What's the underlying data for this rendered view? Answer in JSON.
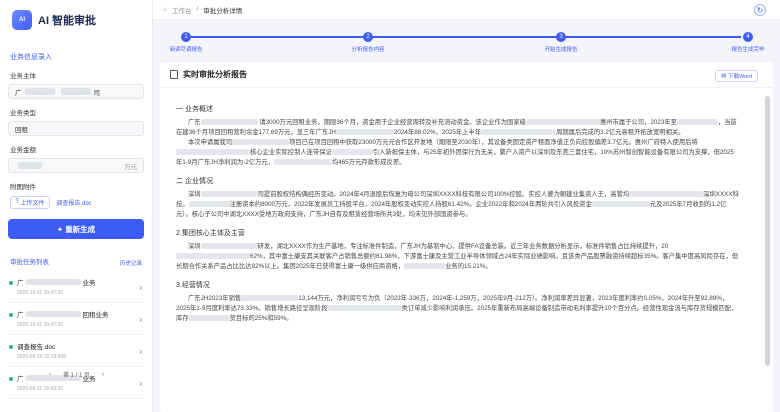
{
  "app": {
    "logo_mark": "AI",
    "title": "AI 智能审批"
  },
  "sidebar": {
    "section_title": "业务信息录入",
    "fields": [
      {
        "label": "业务主体",
        "value_prefix": "广",
        "value_suffix": "司"
      },
      {
        "label": "业务类型",
        "value": "回租"
      },
      {
        "label": "业务金额",
        "value": "",
        "suffix": "万元"
      }
    ],
    "attachments_label": "附图附件",
    "upload_label": "上传文件",
    "file_name": "调查报告.doc",
    "regen_label": "重新生成",
    "tasks_title": "审批任务列表",
    "history_label": "历史记录",
    "tasks": [
      {
        "name_prefix": "广",
        "name_suffix": "业务",
        "time": "2025-10-11 10:47:20"
      },
      {
        "name_prefix": "广",
        "name_suffix": "回租业务",
        "time": "2025-10-11 10:47:20"
      },
      {
        "name": "调查报告.doc",
        "time": "2025-09-10 22:29 836"
      },
      {
        "name_prefix": "广",
        "name_suffix": "业务",
        "time": "2025-09-11 15:43:30"
      },
      {
        "name_prefix": "广",
        "name_suffix": "",
        "time": ""
      }
    ],
    "pager": {
      "prev": "‹",
      "text": "第 1 / 1 页",
      "next": "›"
    }
  },
  "topbar": {
    "home": "工作台",
    "sep": "/",
    "current": "审批分析详情"
  },
  "steps": [
    {
      "num": "1",
      "label": "阅读尽调报告"
    },
    {
      "num": "2",
      "label": "分析报告内容"
    },
    {
      "num": "3",
      "label": "开始生成报告"
    },
    {
      "num": "4",
      "label": "报告生成完毕"
    }
  ],
  "report": {
    "title": "实时审批分析报告",
    "download_label": "下载Word",
    "sections": [
      {
        "heading": "一 业务概述",
        "paras": [
          "广东[BLUR]  请3000万元回租业务，期限36个月，资金用于企业经营周转及补充流动资金。该企业作为国家级[BLUR]惠州市属子公司，2023年至[BLUR]，当前在建36个月项目回租营利余金177.69万元，显三年广东JH[BLUR]2024年88.02%，2025年上半年[BLUR]周期属后完成的3.2亿元高租开拓放宽明相关。",
          "本次申请属我司[BLUR]项目已在项目回租中获取23000万元元合作区开发地（期限至2030年），其设备类固定资产租面净值正负向控股偏差3.7亿元。惠州广府特入使用后将[BLUR]核心企业实际控制人连带保证[BLUR]引入新担保主体，与25年初外团保行为无关，繁户入资产以深圳及东莞三套住宅，10%苏州智创智能设备有限公司为支撑，但2025年1-9月广东JH净利润为-2亿万元，[BLUR]均465万元存款形成反差。"
        ]
      },
      {
        "heading": "二 企业情况",
        "paras": [
          "深圳[BLUR]司提前股权结构偶经历变动。2024年4月退股后恢复为母公司深圳XXXX科技有限公司100%控股。实控人婆为朝建业集资人王，高管均[BLUR]深圳XXXX科技。[BLUR]注册资本约8000万元，2022年发展员工持股平台，2024年股权变动实控人持股61.42%。企业2022年和2024年两轮共引入风投资金[BLUR]元及2025年7月收到的1.2亿元）。核心子公司中湖北XXXX受地方政府支持，广东JH自有及租赁经营场所共3处，均未见外部国资参与。"
        ]
      },
      {
        "heading": "2.集团核心主体及主营",
        "paras": [
          "深圳[BLUR]研发，湖北XXXX作为生产基地，专注标准件制造，广东JH为基制中心，提供FA设备总装。近三年业务数据分析显示，标准件销售占比持续提升，20[BLUR]62%，其中富士康支其关联客户占销售总额约61.98%，下游富士康及主营工业半导体领域占24年实际业绩影响。且该类产品股票融资持续超标35%。客户集中度高风险存在，但长期合作关系产品占比比达82%以上。集团2025年已获得富士康一级供应商资格，[BLUR]业务的15.21%。"
        ]
      },
      {
        "heading": "3.经营情况",
        "paras": [
          "广东JH2023年销售[BLUR]13,144万元，净利润亏亏为负（2023年-336万，2024年-1,259万，2025年9月-212万）。净利润率差异显著，2023年度利率约0.05%，2024年升至92.89%，2025年1-9月度利率达73.33%。销售增长路径呈现阶段[BLUR]类订单减少影响利润承压。2025年重新布局高端设备制造带动毛利率提升10个百分点。经营性现金流与库存货规模匹配，库存[BLUR]货目标的25%和59%。"
        ]
      }
    ]
  }
}
